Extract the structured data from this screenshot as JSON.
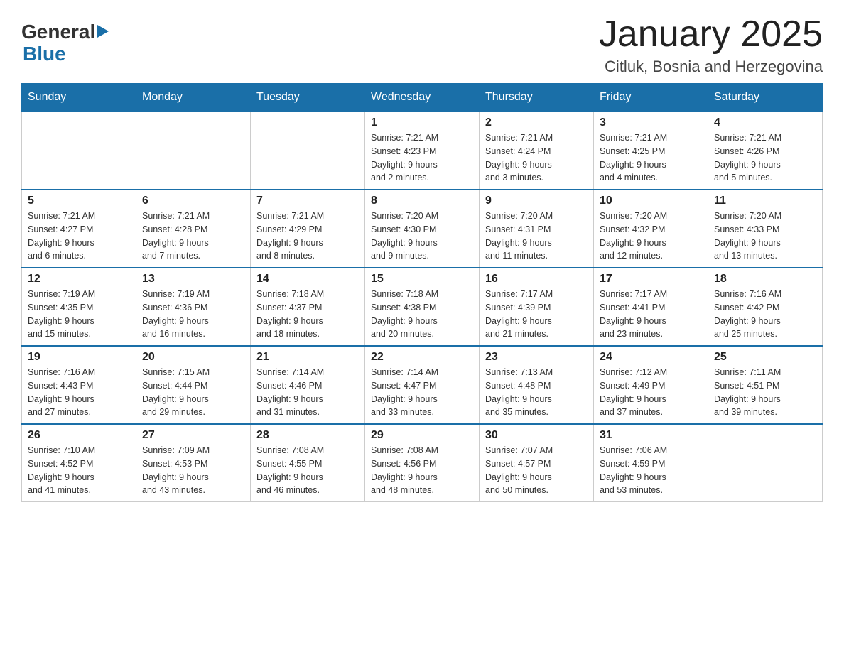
{
  "logo": {
    "general": "General",
    "arrow": "▶",
    "blue": "Blue"
  },
  "title": "January 2025",
  "subtitle": "Citluk, Bosnia and Herzegovina",
  "days_of_week": [
    "Sunday",
    "Monday",
    "Tuesday",
    "Wednesday",
    "Thursday",
    "Friday",
    "Saturday"
  ],
  "weeks": [
    [
      {
        "day": "",
        "info": ""
      },
      {
        "day": "",
        "info": ""
      },
      {
        "day": "",
        "info": ""
      },
      {
        "day": "1",
        "info": "Sunrise: 7:21 AM\nSunset: 4:23 PM\nDaylight: 9 hours\nand 2 minutes."
      },
      {
        "day": "2",
        "info": "Sunrise: 7:21 AM\nSunset: 4:24 PM\nDaylight: 9 hours\nand 3 minutes."
      },
      {
        "day": "3",
        "info": "Sunrise: 7:21 AM\nSunset: 4:25 PM\nDaylight: 9 hours\nand 4 minutes."
      },
      {
        "day": "4",
        "info": "Sunrise: 7:21 AM\nSunset: 4:26 PM\nDaylight: 9 hours\nand 5 minutes."
      }
    ],
    [
      {
        "day": "5",
        "info": "Sunrise: 7:21 AM\nSunset: 4:27 PM\nDaylight: 9 hours\nand 6 minutes."
      },
      {
        "day": "6",
        "info": "Sunrise: 7:21 AM\nSunset: 4:28 PM\nDaylight: 9 hours\nand 7 minutes."
      },
      {
        "day": "7",
        "info": "Sunrise: 7:21 AM\nSunset: 4:29 PM\nDaylight: 9 hours\nand 8 minutes."
      },
      {
        "day": "8",
        "info": "Sunrise: 7:20 AM\nSunset: 4:30 PM\nDaylight: 9 hours\nand 9 minutes."
      },
      {
        "day": "9",
        "info": "Sunrise: 7:20 AM\nSunset: 4:31 PM\nDaylight: 9 hours\nand 11 minutes."
      },
      {
        "day": "10",
        "info": "Sunrise: 7:20 AM\nSunset: 4:32 PM\nDaylight: 9 hours\nand 12 minutes."
      },
      {
        "day": "11",
        "info": "Sunrise: 7:20 AM\nSunset: 4:33 PM\nDaylight: 9 hours\nand 13 minutes."
      }
    ],
    [
      {
        "day": "12",
        "info": "Sunrise: 7:19 AM\nSunset: 4:35 PM\nDaylight: 9 hours\nand 15 minutes."
      },
      {
        "day": "13",
        "info": "Sunrise: 7:19 AM\nSunset: 4:36 PM\nDaylight: 9 hours\nand 16 minutes."
      },
      {
        "day": "14",
        "info": "Sunrise: 7:18 AM\nSunset: 4:37 PM\nDaylight: 9 hours\nand 18 minutes."
      },
      {
        "day": "15",
        "info": "Sunrise: 7:18 AM\nSunset: 4:38 PM\nDaylight: 9 hours\nand 20 minutes."
      },
      {
        "day": "16",
        "info": "Sunrise: 7:17 AM\nSunset: 4:39 PM\nDaylight: 9 hours\nand 21 minutes."
      },
      {
        "day": "17",
        "info": "Sunrise: 7:17 AM\nSunset: 4:41 PM\nDaylight: 9 hours\nand 23 minutes."
      },
      {
        "day": "18",
        "info": "Sunrise: 7:16 AM\nSunset: 4:42 PM\nDaylight: 9 hours\nand 25 minutes."
      }
    ],
    [
      {
        "day": "19",
        "info": "Sunrise: 7:16 AM\nSunset: 4:43 PM\nDaylight: 9 hours\nand 27 minutes."
      },
      {
        "day": "20",
        "info": "Sunrise: 7:15 AM\nSunset: 4:44 PM\nDaylight: 9 hours\nand 29 minutes."
      },
      {
        "day": "21",
        "info": "Sunrise: 7:14 AM\nSunset: 4:46 PM\nDaylight: 9 hours\nand 31 minutes."
      },
      {
        "day": "22",
        "info": "Sunrise: 7:14 AM\nSunset: 4:47 PM\nDaylight: 9 hours\nand 33 minutes."
      },
      {
        "day": "23",
        "info": "Sunrise: 7:13 AM\nSunset: 4:48 PM\nDaylight: 9 hours\nand 35 minutes."
      },
      {
        "day": "24",
        "info": "Sunrise: 7:12 AM\nSunset: 4:49 PM\nDaylight: 9 hours\nand 37 minutes."
      },
      {
        "day": "25",
        "info": "Sunrise: 7:11 AM\nSunset: 4:51 PM\nDaylight: 9 hours\nand 39 minutes."
      }
    ],
    [
      {
        "day": "26",
        "info": "Sunrise: 7:10 AM\nSunset: 4:52 PM\nDaylight: 9 hours\nand 41 minutes."
      },
      {
        "day": "27",
        "info": "Sunrise: 7:09 AM\nSunset: 4:53 PM\nDaylight: 9 hours\nand 43 minutes."
      },
      {
        "day": "28",
        "info": "Sunrise: 7:08 AM\nSunset: 4:55 PM\nDaylight: 9 hours\nand 46 minutes."
      },
      {
        "day": "29",
        "info": "Sunrise: 7:08 AM\nSunset: 4:56 PM\nDaylight: 9 hours\nand 48 minutes."
      },
      {
        "day": "30",
        "info": "Sunrise: 7:07 AM\nSunset: 4:57 PM\nDaylight: 9 hours\nand 50 minutes."
      },
      {
        "day": "31",
        "info": "Sunrise: 7:06 AM\nSunset: 4:59 PM\nDaylight: 9 hours\nand 53 minutes."
      },
      {
        "day": "",
        "info": ""
      }
    ]
  ]
}
